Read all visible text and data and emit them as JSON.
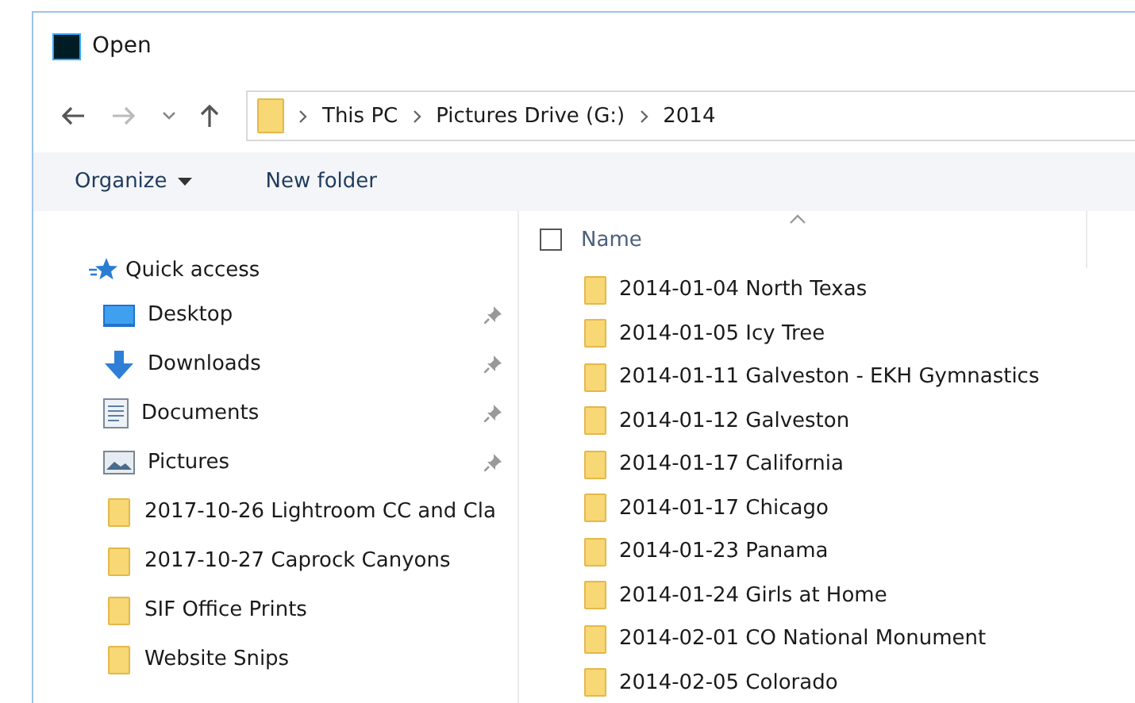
{
  "window": {
    "title": "Open"
  },
  "address_bar": {
    "path": [
      "This PC",
      "Pictures Drive (G:)",
      "2014"
    ]
  },
  "toolbar": {
    "organize": "Organize",
    "new_folder": "New folder"
  },
  "sidebar": {
    "header": "Quick access",
    "items": [
      {
        "label": "Desktop",
        "kind": "desktop",
        "pinned": true
      },
      {
        "label": "Downloads",
        "kind": "downloads",
        "pinned": true
      },
      {
        "label": "Documents",
        "kind": "documents",
        "pinned": true
      },
      {
        "label": "Pictures",
        "kind": "pictures",
        "pinned": true
      },
      {
        "label": "2017-10-26 Lightroom CC and Cla",
        "kind": "folder",
        "pinned": false
      },
      {
        "label": "2017-10-27 Caprock Canyons",
        "kind": "folder",
        "pinned": false
      },
      {
        "label": "SIF Office Prints",
        "kind": "folder",
        "pinned": false
      },
      {
        "label": "Website Snips",
        "kind": "folder",
        "pinned": false
      }
    ]
  },
  "file_list": {
    "columns": [
      {
        "label": "Name",
        "sorted": true
      }
    ],
    "select_all": {
      "checked": false
    },
    "rows": [
      "2014-01-04 North Texas",
      "2014-01-05 Icy Tree",
      "2014-01-11 Galveston - EKH Gymnastics",
      "2014-01-12 Galveston",
      "2014-01-17 California",
      "2014-01-17 Chicago",
      "2014-01-23 Panama",
      "2014-01-24 Girls at Home",
      "2014-02-01 CO National Monument",
      "2014-02-05 Colorado"
    ]
  }
}
